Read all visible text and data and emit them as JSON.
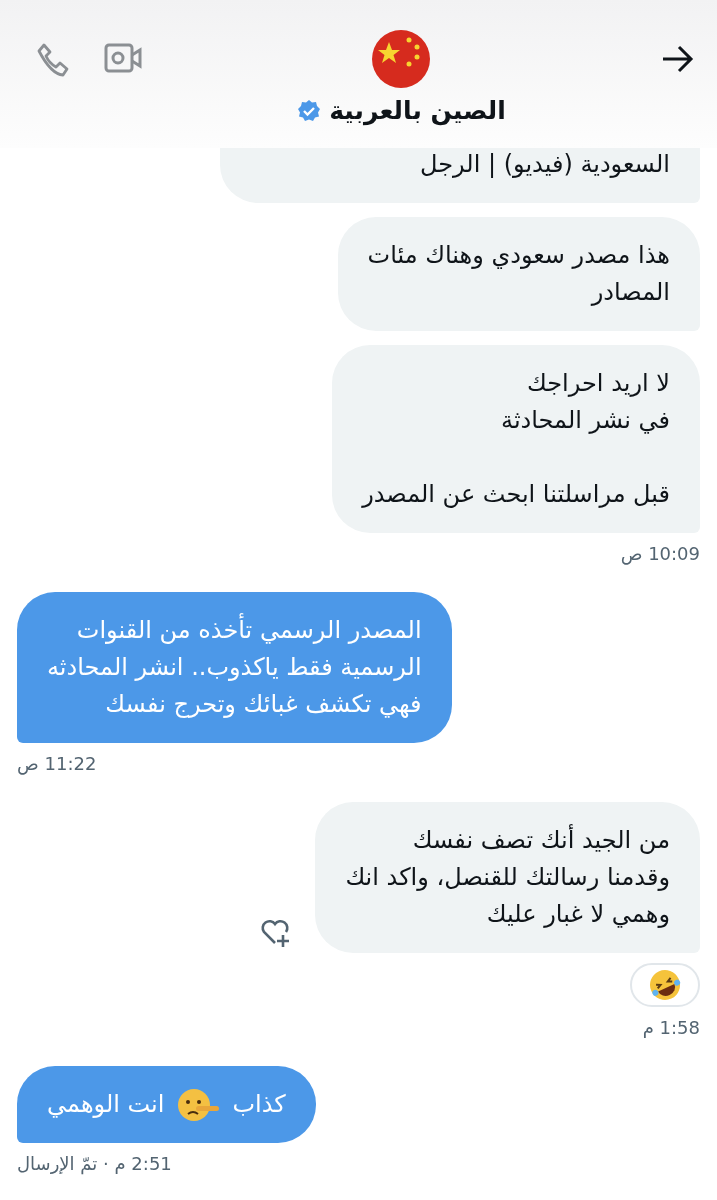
{
  "header": {
    "title": "الصين بالعربية",
    "verified": true
  },
  "messages": [
    {
      "kind": "received",
      "text": "السعودية (فيديو) | الرجل",
      "cut_top": true
    },
    {
      "kind": "received",
      "text": "هذا مصدر سعودي وهناك مئات\nالمصادر"
    },
    {
      "kind": "received",
      "text": "لا اريد احراجك\nفي نشر المحادثة\n\nقبل مراسلتنا ابحث عن المصدر",
      "time": "10:09 ص"
    },
    {
      "kind": "sent",
      "text": "المصدر الرسمي تأخذه من القنوات\nالرسمية فقط ياكذوب.. انشر المحادثه\nفهي تكشف غبائك وتحرج نفسك",
      "time": "11:22 ص"
    },
    {
      "kind": "received",
      "text": "من الجيد أنك تصف نفسك\nوقدمنا رسالتك للقنصل، واكد انك\nوهمي لا غبار عليك",
      "react_button": true,
      "reaction": {
        "kind": "laughing"
      },
      "time": "1:58 م"
    },
    {
      "kind": "sent",
      "segments": [
        {
          "kind": "text",
          "text": "كذاب"
        },
        {
          "kind": "lying-face"
        },
        {
          "kind": "text",
          "text": "انت الوهمي"
        }
      ],
      "time": "2:51 م · تمّ الإرسال"
    }
  ]
}
